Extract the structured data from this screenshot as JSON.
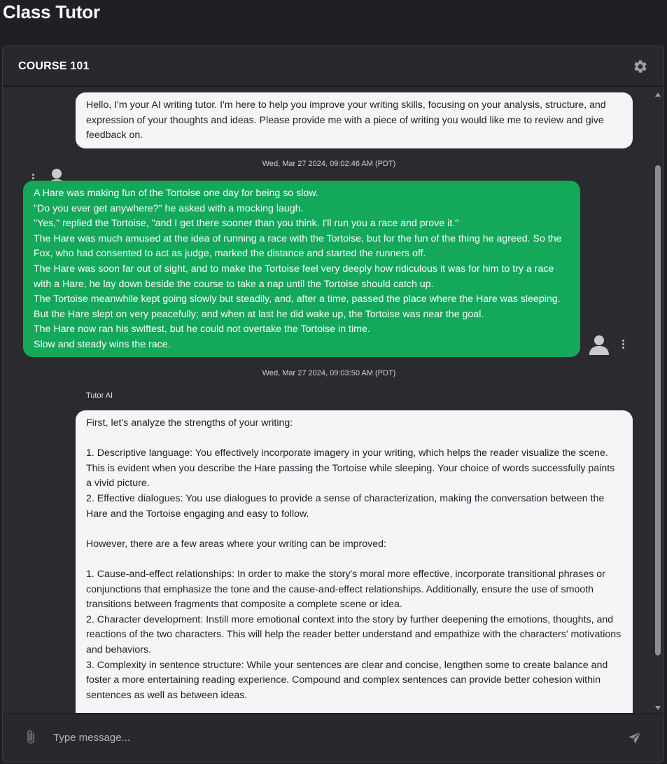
{
  "app": {
    "title": "Class Tutor"
  },
  "course": {
    "name": "COURSE 101"
  },
  "colors": {
    "background": "#1f2023",
    "panel": "#2a2b2f",
    "user_bubble": "#13a85a",
    "ai_bubble": "#f4f5f7"
  },
  "messages": [
    {
      "role": "ai",
      "avatar_icon": "user-avatar-icon",
      "text": "Hello, I'm your AI writing tutor. I'm here to help you improve your writing skills, focusing on your analysis, structure, and expression of your thoughts and ideas. Please provide me with a piece of writing you would like me to review and give feedback on.",
      "timestamp": "Wed, Mar 27 2024, 09:02:46 AM (PDT)"
    },
    {
      "role": "user",
      "avatar_icon": "user-avatar-icon",
      "text": "A Hare was making fun of the Tortoise one day for being so slow.\n\"Do you ever get anywhere?\" he asked with a mocking laugh.\n\"Yes,\" replied the Tortoise, \"and I get there sooner than you think. I'll run you a race and prove it.\"\nThe Hare was much amused at the idea of running a race with the Tortoise, but for the fun of the thing he agreed. So the Fox, who had consented to act as judge, marked the distance and started the runners off.\nThe Hare was soon far out of sight, and to make the Tortoise feel very deeply how ridiculous it was for him to try a race with a Hare, he lay down beside the course to take a nap until the Tortoise should catch up.\nThe Tortoise meanwhile kept going slowly but steadily, and, after a time, passed the place where the Hare was sleeping. But the Hare slept on very peacefully; and when at last he did wake up, the Tortoise was near the goal.\nThe Hare now ran his swiftest, but he could not overtake the Tortoise in time.\nSlow and steady wins the race.",
      "timestamp": "Wed, Mar 27 2024, 09:03:50 AM (PDT)"
    },
    {
      "role": "ai",
      "sender": "Tutor AI",
      "text": "First, let's analyze the strengths of your writing:\n\n1. Descriptive language: You effectively incorporate imagery in your writing, which helps the reader visualize the scene. This is evident when you describe the Hare passing the Tortoise while sleeping. Your choice of words successfully paints a vivid picture.\n2. Effective dialogues: You use dialogues to provide a sense of characterization, making the conversation between the Hare and the Tortoise engaging and easy to follow.\n\nHowever, there are a few areas where your writing can be improved:\n\n1. Cause-and-effect relationships: In order to make the story's moral more effective, incorporate transitional phrases or conjunctions that emphasize the tone and the cause-and-effect relationships. Additionally, ensure the use of smooth transitions between fragments that composite a complete scene or idea.\n2. Character development: Instill more emotional context into the story by further deepening the emotions, thoughts, and reactions of the two characters. This will help the reader better understand and empathize with the characters' motivations and behaviors.\n3. Complexity in sentence structure: While your sentences are clear and concise, lengthen some to create balance and foster a more entertaining reading experience. Compound and complex sentences can provide better cohesion within sentences as well as between ideas."
    }
  ],
  "composer": {
    "placeholder": "Type message...",
    "value": "",
    "attach_icon": "paperclip-icon",
    "send_icon": "send-icon"
  },
  "header": {
    "settings_icon": "gear-icon"
  }
}
